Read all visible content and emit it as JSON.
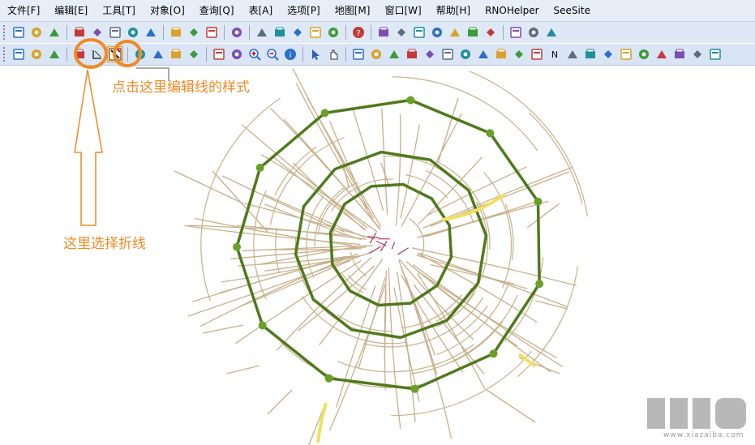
{
  "menu": [
    "文件[F]",
    "编辑[E]",
    "工具[T]",
    "对象[O]",
    "查询[Q]",
    "表[A]",
    "选项[P]",
    "地图[M]",
    "窗口[W]",
    "帮助[H]",
    "RNOHelper",
    "SeeSite"
  ],
  "toolbar1": {
    "icons": [
      "new-icon",
      "open-icon",
      "open-workspace-icon",
      "save-icon",
      "save-as-icon",
      "open-table-icon",
      "print-setup-icon",
      "print-icon",
      "cut-icon",
      "copy-icon",
      "paste-icon",
      "undo-icon",
      "new-browser-icon",
      "new-mapper-icon",
      "new-grapher-icon",
      "new-layout-icon",
      "redistrict-icon",
      "help-icon",
      "tool-a-icon",
      "tool-b-icon",
      "tool-c-icon",
      "tool-d-icon",
      "tool-e-icon",
      "tool-f-icon",
      "tool-g-icon",
      "tool-h-icon",
      "tool-i-icon",
      "tool-j-icon"
    ]
  },
  "toolbar2": {
    "icons": [
      "open-icon",
      "save-icon",
      "undo-icon",
      "polyline-select-icon",
      "polyline-icon",
      "line-style-icon",
      "browser-icon",
      "legend-icon",
      "layer-icon",
      "ruler-icon",
      "select-icon",
      "radius-select-icon",
      "zoom-in-icon",
      "zoom-out-icon",
      "info-icon",
      "pointer-icon",
      "grabber-icon"
    ],
    "right_icons": [
      "icon-1",
      "icon-2",
      "icon-3",
      "icon-4",
      "icon-5",
      "icon-6",
      "icon-7",
      "icon-8",
      "icon-9",
      "icon-10",
      "icon-11",
      "N",
      "icon-13",
      "icon-14",
      "icon-15",
      "icon-16",
      "icon-17",
      "icon-18",
      "icon-19",
      "icon-20",
      "icon-21"
    ]
  },
  "annotations": {
    "line_style_hint": "点击这里编辑线的样式",
    "polyline_hint": "这里选择折线"
  },
  "watermark": {
    "site": "www.xiazaiba.com"
  },
  "colors": {
    "accent": "#f08a24",
    "ring_road": "#4e7a1c",
    "street": "#c7b08a",
    "highway": "#f0e060"
  }
}
